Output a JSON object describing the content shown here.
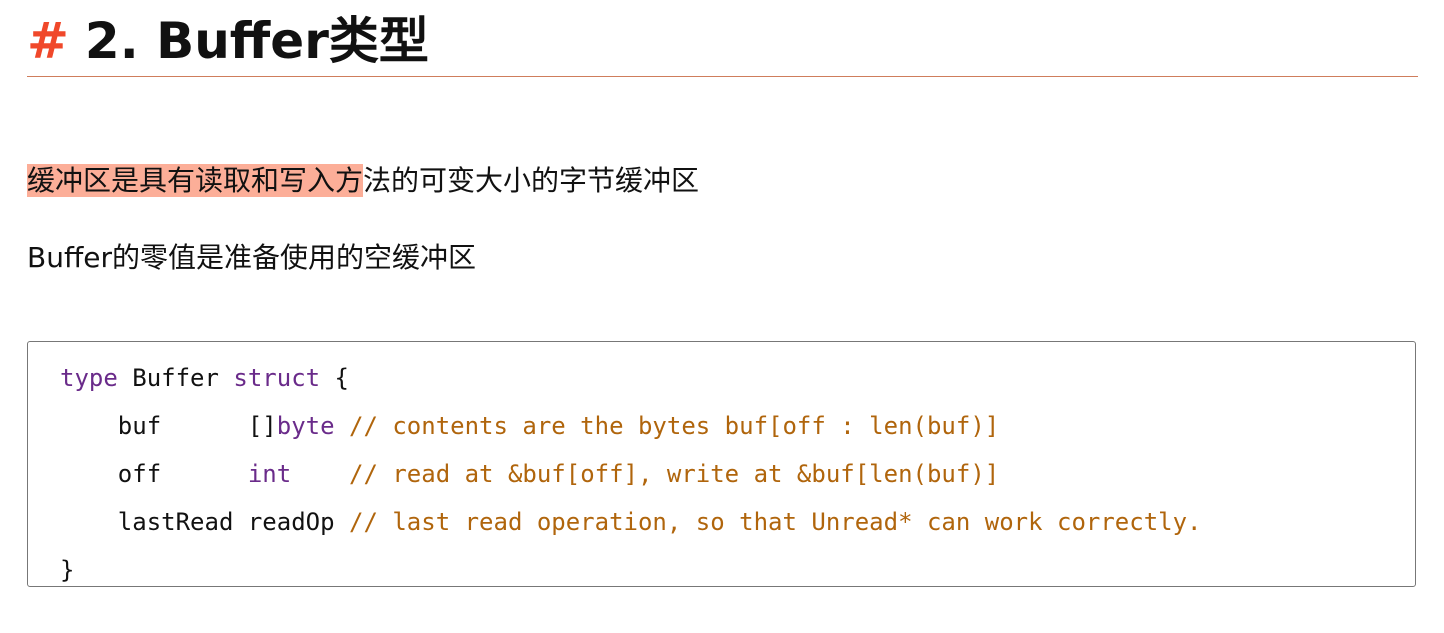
{
  "heading": {
    "hash": "#",
    "title": "2. Buffer类型"
  },
  "paragraphs": [
    {
      "highlighted": "缓冲区是具有读取和写入方",
      "rest": "法的可变大小的字节缓冲区"
    },
    {
      "text": "Buffer的零值是准备使用的空缓冲区"
    }
  ],
  "code": {
    "line1": {
      "kw1": "type",
      "name": " Buffer ",
      "kw2": "struct",
      "brace": " {"
    },
    "line2": {
      "indent": "    buf      []",
      "type": "byte",
      "comment": " // contents are the bytes buf[off : len(buf)]"
    },
    "line3": {
      "indent": "    off      ",
      "type": "int",
      "comment": "    // read at &buf[off], write at &buf[len(buf)]"
    },
    "line4": {
      "indent": "    lastRead readOp",
      "comment": " // last read operation, so that Unread* can work correctly."
    },
    "line5": {
      "brace": "}"
    }
  },
  "colors": {
    "hash": "#f0482a",
    "rule": "#cf7d5c",
    "highlight": "#fcae98",
    "keyword": "#6a2b8a",
    "comment": "#b0650c"
  }
}
